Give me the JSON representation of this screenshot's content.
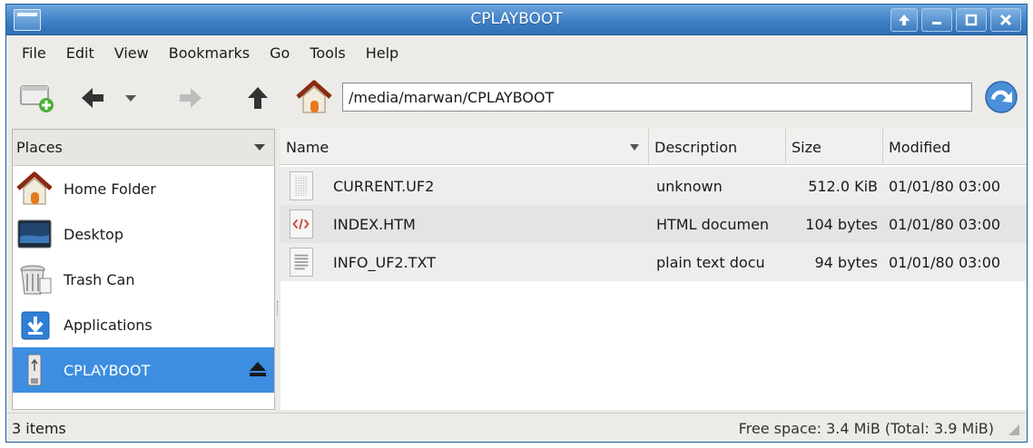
{
  "window": {
    "title": "CPLAYBOOT",
    "accent": "#3d8ee0"
  },
  "menu": [
    "File",
    "Edit",
    "View",
    "Bookmarks",
    "Go",
    "Tools",
    "Help"
  ],
  "toolbar": {
    "address": "/media/marwan/CPLAYBOOT",
    "icons": [
      "new-tab-icon",
      "back-arrow-icon",
      "history-dropdown-icon",
      "forward-arrow-icon",
      "up-arrow-icon",
      "home-icon",
      "go-refresh-icon"
    ]
  },
  "sidebar": {
    "header": "Places",
    "items": [
      {
        "label": "Home Folder",
        "icon": "home-folder-icon"
      },
      {
        "label": "Desktop",
        "icon": "desktop-icon"
      },
      {
        "label": "Trash Can",
        "icon": "trash-can-icon"
      },
      {
        "label": "Applications",
        "icon": "applications-icon"
      },
      {
        "label": "CPLAYBOOT",
        "icon": "usb-drive-icon",
        "selected": true
      }
    ]
  },
  "filelist": {
    "columns": [
      "Name",
      "Description",
      "Size",
      "Modified"
    ],
    "rows": [
      {
        "name": "CURRENT.UF2",
        "description": "unknown",
        "size": "512.0 KiB",
        "modified": "01/01/80 03:00",
        "icon": "unknown-file-icon"
      },
      {
        "name": "INDEX.HTM",
        "description": "HTML documen",
        "size": "104 bytes",
        "modified": "01/01/80 03:00",
        "icon": "html-file-icon"
      },
      {
        "name": "INFO_UF2.TXT",
        "description": "plain text docu",
        "size": "94 bytes",
        "modified": "01/01/80 03:00",
        "icon": "text-file-icon"
      }
    ]
  },
  "status": {
    "items": "3 items",
    "free": "Free space: 3.4 MiB (Total: 3.9 MiB)"
  }
}
